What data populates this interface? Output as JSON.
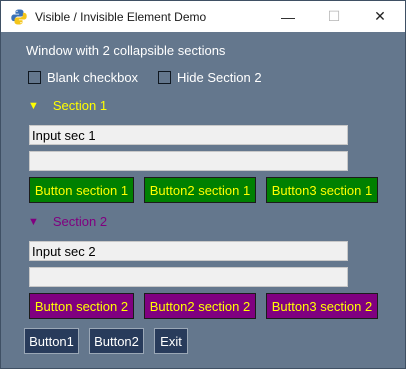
{
  "window": {
    "title": "Visible / Invisible Element Demo",
    "minimize_icon": "minimize-icon",
    "maximize_icon": "maximize-icon",
    "close_icon": "close-icon",
    "app_icon": "python-icon"
  },
  "colors": {
    "window_bg": "#64778d",
    "section1_color": "#ffff00",
    "section2_color": "#800080",
    "button_green": "#008000",
    "button_purple": "#800080",
    "button_text": "#ffff00",
    "bottom_button_bg": "#283b5b"
  },
  "intro": {
    "text": "Window with 2 collapsible sections"
  },
  "checkboxes": {
    "blank": {
      "label": "Blank checkbox",
      "checked": false
    },
    "hide_section2": {
      "label": "Hide Section 2",
      "checked": false
    }
  },
  "section1": {
    "arrow": "▼",
    "title": "Section 1",
    "input1_value": "Input sec 1",
    "input2_value": "",
    "buttons": [
      "Button section 1",
      "Button2 section 1",
      "Button3 section 1"
    ]
  },
  "section2": {
    "arrow": "▼",
    "title": "Section 2",
    "input1_value": "Input sec 2",
    "input2_value": "",
    "buttons": [
      "Button section 2",
      "Button2 section 2",
      "Button3 section 2"
    ]
  },
  "bottom_buttons": [
    "Button1",
    "Button2",
    "Exit"
  ]
}
